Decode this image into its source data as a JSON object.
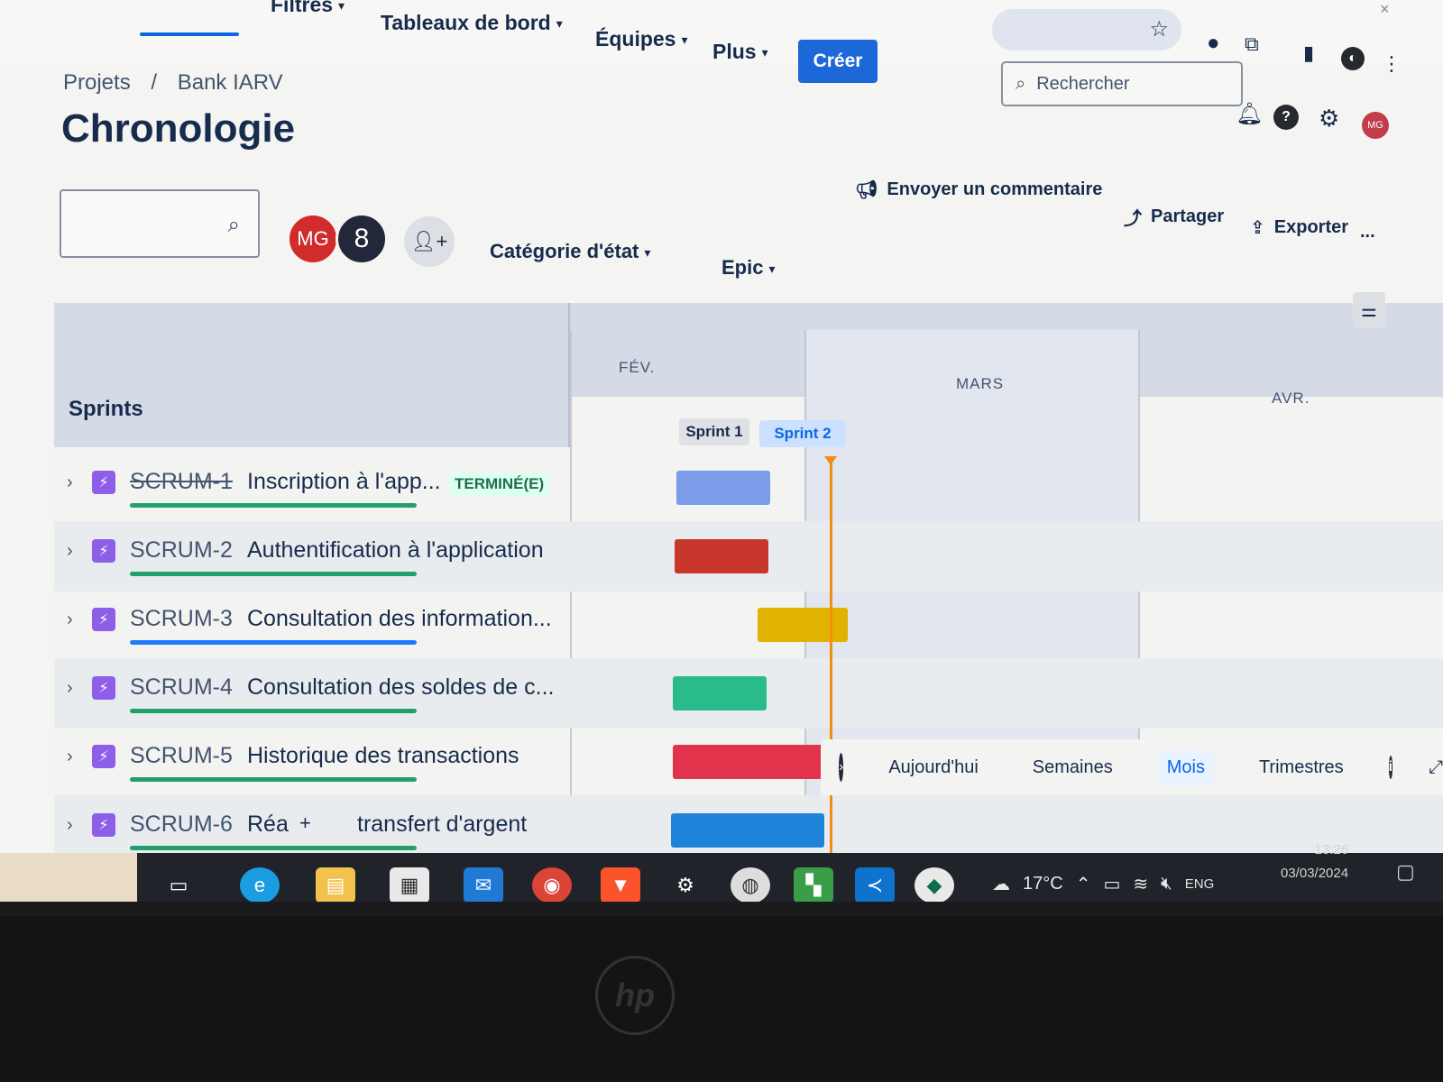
{
  "app": {
    "colors": {
      "accent": "#0c66e4",
      "create": "#1d68d8"
    }
  },
  "topnav": {
    "items": [
      "Filtres",
      "Tableaux de bord",
      "Équipes",
      "Plus"
    ],
    "create_label": "Créer",
    "search_placeholder": "Rechercher",
    "avatar_initials": "MG"
  },
  "breadcrumb": {
    "root": "Projets",
    "separator": "/",
    "project": "Bank IARV"
  },
  "page_title": "Chronologie",
  "toolbar": {
    "avatar_initials": "MG",
    "filters": [
      "Catégorie d'état",
      "Epic"
    ],
    "actions": {
      "feedback": "Envoyer un commentaire",
      "share": "Partager",
      "export": "Exporter",
      "more": "..."
    }
  },
  "timeline": {
    "column_title": "Sprints",
    "months": [
      "FÉV.",
      "MARS",
      "AVR."
    ],
    "sprints": [
      "Sprint 1",
      "Sprint 2"
    ],
    "rows": [
      {
        "key": "SCRUM-1",
        "title": "Inscription à l'app...",
        "status": "TERMINÉ(E)",
        "done": true,
        "bar_color": "#7b9ce8",
        "progress_color": "#22a06b"
      },
      {
        "key": "SCRUM-2",
        "title": "Authentification à l'application",
        "bar_color": "#c9372c",
        "progress_color": "#22a06b"
      },
      {
        "key": "SCRUM-3",
        "title": "Consultation des information...",
        "bar_color": "#e2b203",
        "progress_color": "#1d7afc"
      },
      {
        "key": "SCRUM-4",
        "title": "Consultation des soldes de c...",
        "bar_color": "#2abb8a",
        "progress_color": "#22a06b"
      },
      {
        "key": "SCRUM-5",
        "title": "Historique des transactions",
        "bar_color": "#e2334d",
        "progress_color": "#22a06b"
      },
      {
        "key": "SCRUM-6",
        "title": "Réa",
        "title_tail": "transfert d'argent",
        "bar_color": "#1d84d9",
        "progress_color": "#22a06b"
      }
    ],
    "view_options": [
      "Aujourd'hui",
      "Semaines",
      "Mois",
      "Trimestres"
    ],
    "active_view": "Mois"
  },
  "taskbar": {
    "weather": "17°C",
    "language": "ENG",
    "time": "13:26",
    "date": "03/03/2024"
  }
}
